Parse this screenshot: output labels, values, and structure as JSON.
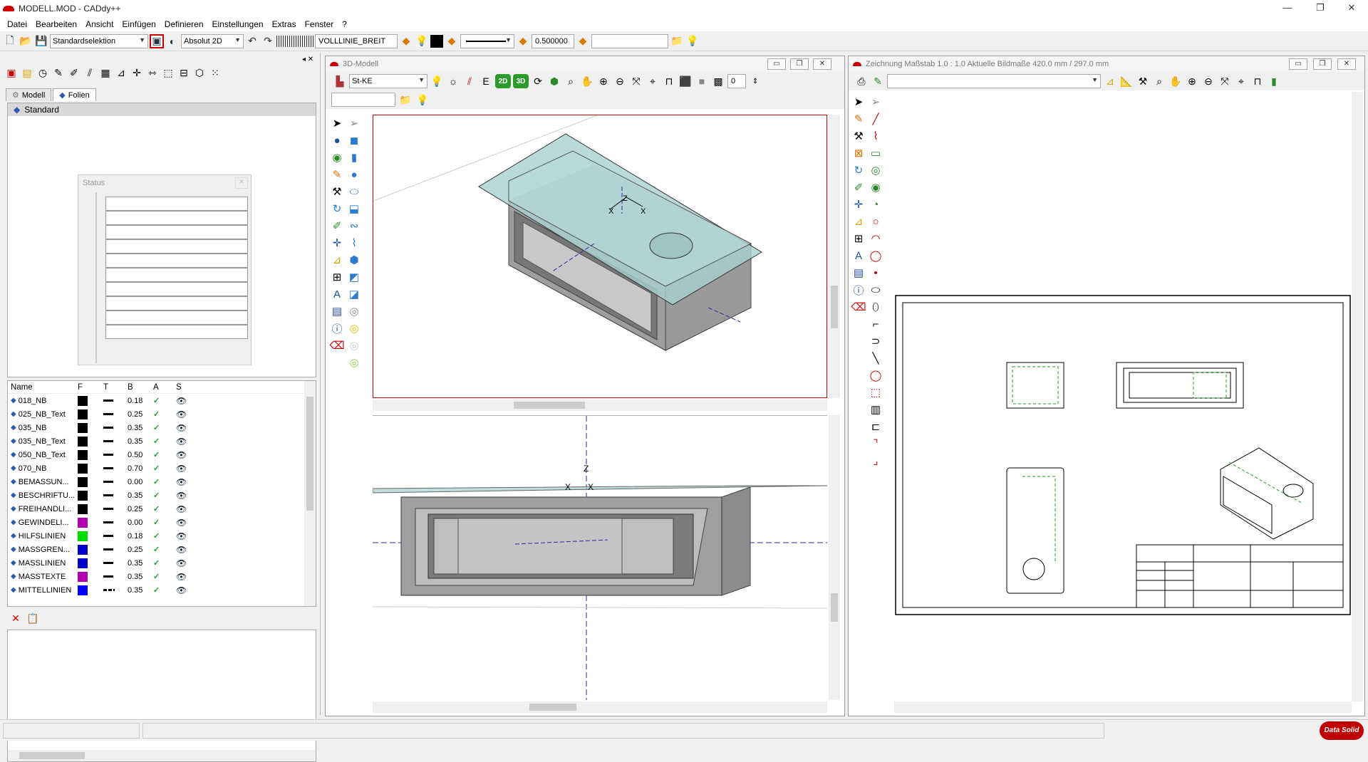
{
  "window": {
    "title": "MODELL.MOD  -  CADdy++",
    "minimize": "—",
    "maximize": "❐",
    "close": "✕"
  },
  "menu": [
    "Datei",
    "Bearbeiten",
    "Ansicht",
    "Einfügen",
    "Definieren",
    "Einstellungen",
    "Extras",
    "Fenster",
    "?"
  ],
  "toolbar": {
    "selection_mode": "Standardselektion",
    "coord_mode": "Absolut 2D",
    "linetype": "VOLLLINIE_BREIT",
    "linewidth": "0.500000",
    "search_value": ""
  },
  "left": {
    "tabs": [
      {
        "label": "Modell"
      },
      {
        "label": "Folien"
      }
    ],
    "tree_root": "Standard",
    "status_title": "Status",
    "status_close": "✕",
    "columns": [
      "Name",
      "F",
      "T",
      "B",
      "A",
      "S"
    ],
    "layers": [
      {
        "name": "018_NB",
        "color": "#000000",
        "width": "0.18",
        "dashed": false
      },
      {
        "name": "025_NB_Text",
        "color": "#000000",
        "width": "0.25",
        "dashed": false
      },
      {
        "name": "035_NB",
        "color": "#000000",
        "width": "0.35",
        "dashed": false
      },
      {
        "name": "035_NB_Text",
        "color": "#000000",
        "width": "0.35",
        "dashed": false
      },
      {
        "name": "050_NB_Text",
        "color": "#000000",
        "width": "0.50",
        "dashed": false
      },
      {
        "name": "070_NB",
        "color": "#000000",
        "width": "0.70",
        "dashed": false
      },
      {
        "name": "BEMASSUN...",
        "color": "#000000",
        "width": "0.00",
        "dashed": false
      },
      {
        "name": "BESCHRIFTU...",
        "color": "#000000",
        "width": "0.35",
        "dashed": false
      },
      {
        "name": "FREIHANDLI...",
        "color": "#000000",
        "width": "0.25",
        "dashed": false
      },
      {
        "name": "GEWINDELI...",
        "color": "#b000b0",
        "width": "0.00",
        "dashed": false
      },
      {
        "name": "HILFSLINIEN",
        "color": "#00dd00",
        "width": "0.18",
        "dashed": false
      },
      {
        "name": "MASSGREN...",
        "color": "#0000cc",
        "width": "0.25",
        "dashed": false
      },
      {
        "name": "MASSLINIEN",
        "color": "#0000cc",
        "width": "0.35",
        "dashed": false
      },
      {
        "name": "MASSTEXTE",
        "color": "#b000b0",
        "width": "0.35",
        "dashed": false
      },
      {
        "name": "MITTELLINIEN",
        "color": "#0000ff",
        "width": "0.35",
        "dashed": true
      }
    ]
  },
  "model3d": {
    "title": "3D-Modell",
    "material": "St-KE",
    "btn_2d": "2D",
    "btn_3d": "3D",
    "level": "0",
    "input_value": ""
  },
  "drawing": {
    "title": "Zeichnung   Maßstab 1.0 : 1.0   Aktuelle Bildmaße 420.0 mm / 297.0 mm",
    "view_select": ""
  },
  "brand": "Data Solid",
  "colors": {
    "accent": "#c00000",
    "plate": "#a9cfcf",
    "body": "#8c8c8c"
  }
}
